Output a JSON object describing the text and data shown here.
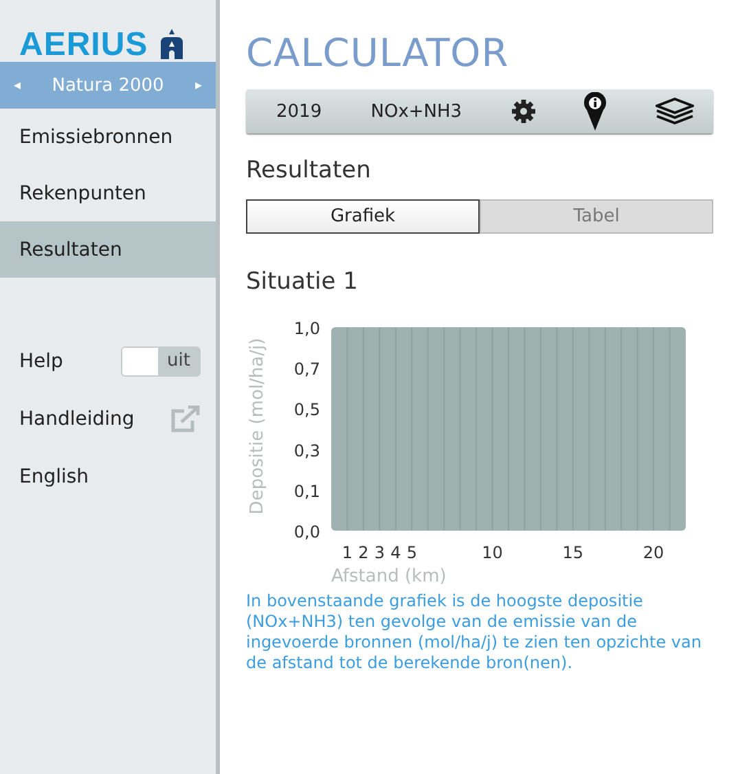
{
  "sidebar": {
    "logo": "AERIUS",
    "area_selector": {
      "prev": "◂",
      "label": "Natura 2000",
      "next": "▸"
    },
    "items": [
      {
        "label": "Emissiebronnen",
        "selected": false
      },
      {
        "label": "Rekenpunten",
        "selected": false
      },
      {
        "label": "Resultaten",
        "selected": true
      }
    ],
    "help": {
      "label": "Help",
      "toggle_text": "uit",
      "on": false
    },
    "links": [
      {
        "label": "Handleiding",
        "kind": "external"
      },
      {
        "label": "English",
        "kind": "plain"
      }
    ]
  },
  "header": {
    "title": "CALCULATOR"
  },
  "toolbar": {
    "year": "2019",
    "substance": "NOx+NH3"
  },
  "section_title": "Resultaten",
  "tabs": [
    {
      "label": "Grafiek",
      "selected": true
    },
    {
      "label": "Tabel",
      "selected": false
    }
  ],
  "situation_title": "Situatie 1",
  "chart": {
    "xlabel": "Afstand (km)",
    "ylabel": "Depositie (mol/ha/j)",
    "x_axis_labels": [
      "1",
      "2",
      "3",
      "4",
      "5",
      "10",
      "15",
      "20"
    ],
    "y_axis_labels": [
      "1,0",
      "0,7",
      "0,5",
      "0,3",
      "0,1",
      "0,0"
    ]
  },
  "description": "In bovenstaande grafiek is de hoogste depositie (NOx+NH3) ten gevolge van de emissie van de ingevoerde bronnen (mol/ha/j) te zien ten opzichte van de afstand tot de berekende bron(nen)."
}
